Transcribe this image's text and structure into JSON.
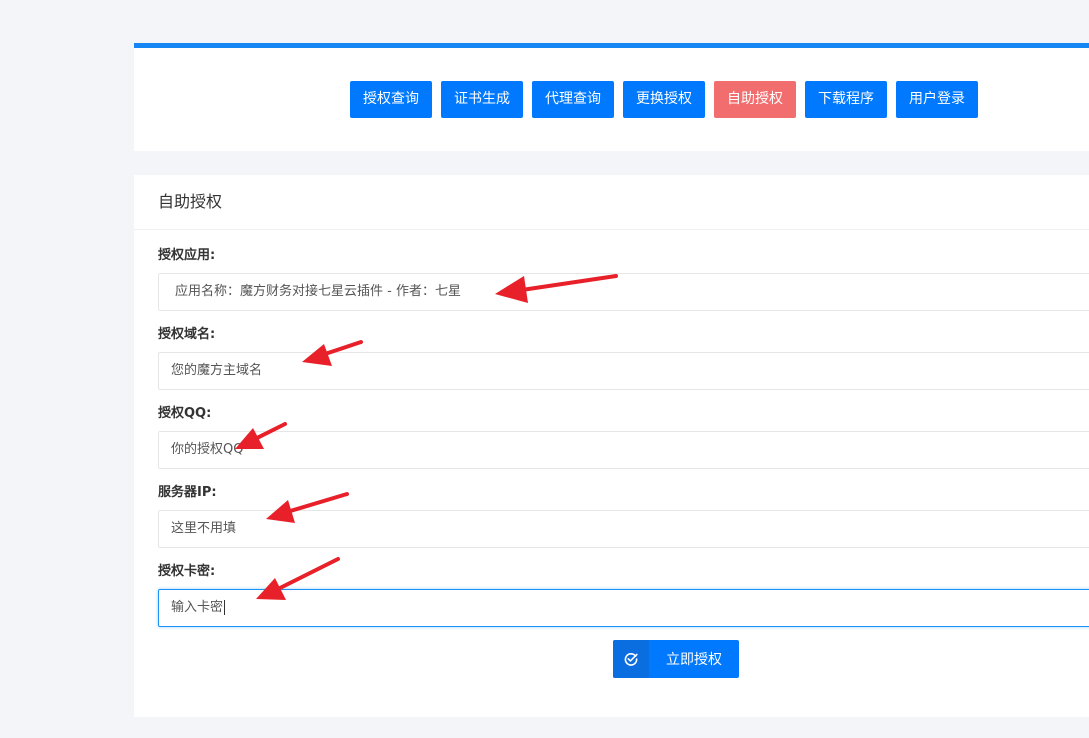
{
  "nav": {
    "buttons": [
      {
        "label": "授权查询"
      },
      {
        "label": "证书生成"
      },
      {
        "label": "代理查询"
      },
      {
        "label": "更换授权"
      },
      {
        "label": "自助授权",
        "active": true
      },
      {
        "label": "下载程序"
      },
      {
        "label": "用户登录"
      }
    ]
  },
  "card": {
    "title": "自助授权",
    "fields": [
      {
        "label": "授权应用:",
        "value": "应用名称：魔方财务对接七星云插件 - 作者：七星"
      },
      {
        "label": "授权域名:",
        "placeholder": "您的魔方主域名"
      },
      {
        "label": "授权QQ:",
        "placeholder": "你的授权QQ"
      },
      {
        "label": "服务器IP:",
        "placeholder": "这里不用填"
      },
      {
        "label": "授权卡密:",
        "placeholder": "输入卡密"
      }
    ],
    "submit_label": "立即授权"
  },
  "colors": {
    "accent": "#0079fe",
    "active_tab": "#f26e6e",
    "top_border": "#1686f5",
    "annotation_arrow": "#e8202a"
  },
  "icons": {
    "submit": "check-circle-icon",
    "annotations": "red-arrow-icon"
  }
}
